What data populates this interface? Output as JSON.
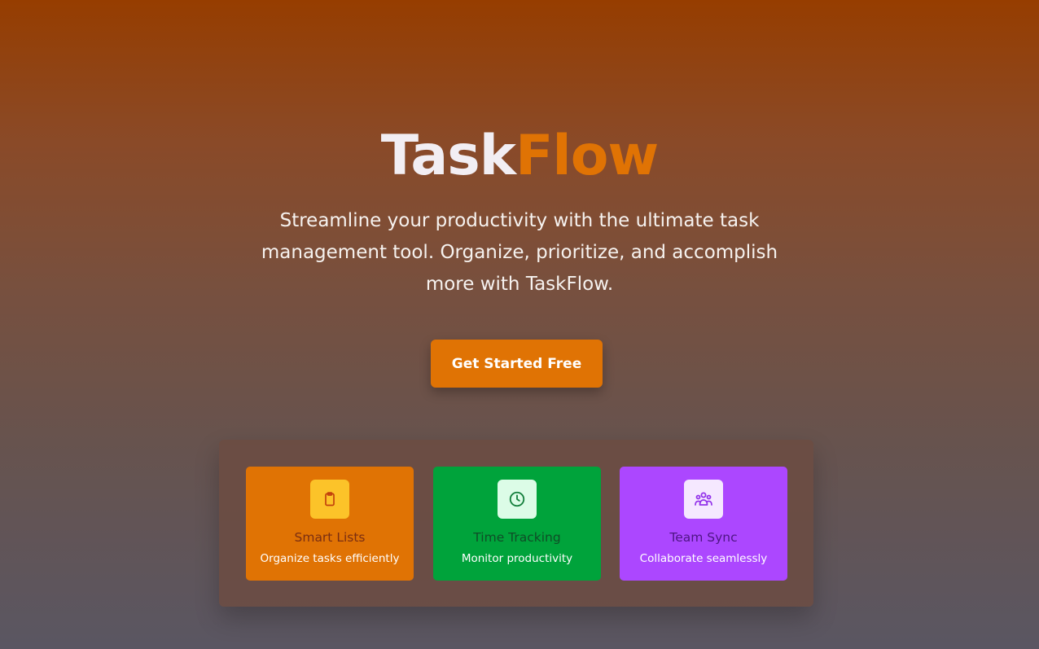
{
  "hero": {
    "title_part1": "Task",
    "title_part2": "Flow",
    "subtitle": "Streamline your productivity with the ultimate task management tool. Organize, prioritize, and accomplish more with TaskFlow.",
    "cta_label": "Get Started Free"
  },
  "features": [
    {
      "title": "Smart Lists",
      "description": "Organize tasks efficiently",
      "icon": "clipboard-icon"
    },
    {
      "title": "Time Tracking",
      "description": "Monitor productivity",
      "icon": "clock-icon"
    },
    {
      "title": "Team Sync",
      "description": "Collaborate seamlessly",
      "icon": "users-icon"
    }
  ],
  "colors": {
    "accent": "#e07304",
    "smart_lists": "#e07304",
    "time_tracking": "#00a33b",
    "team_sync": "#ac47ff"
  }
}
